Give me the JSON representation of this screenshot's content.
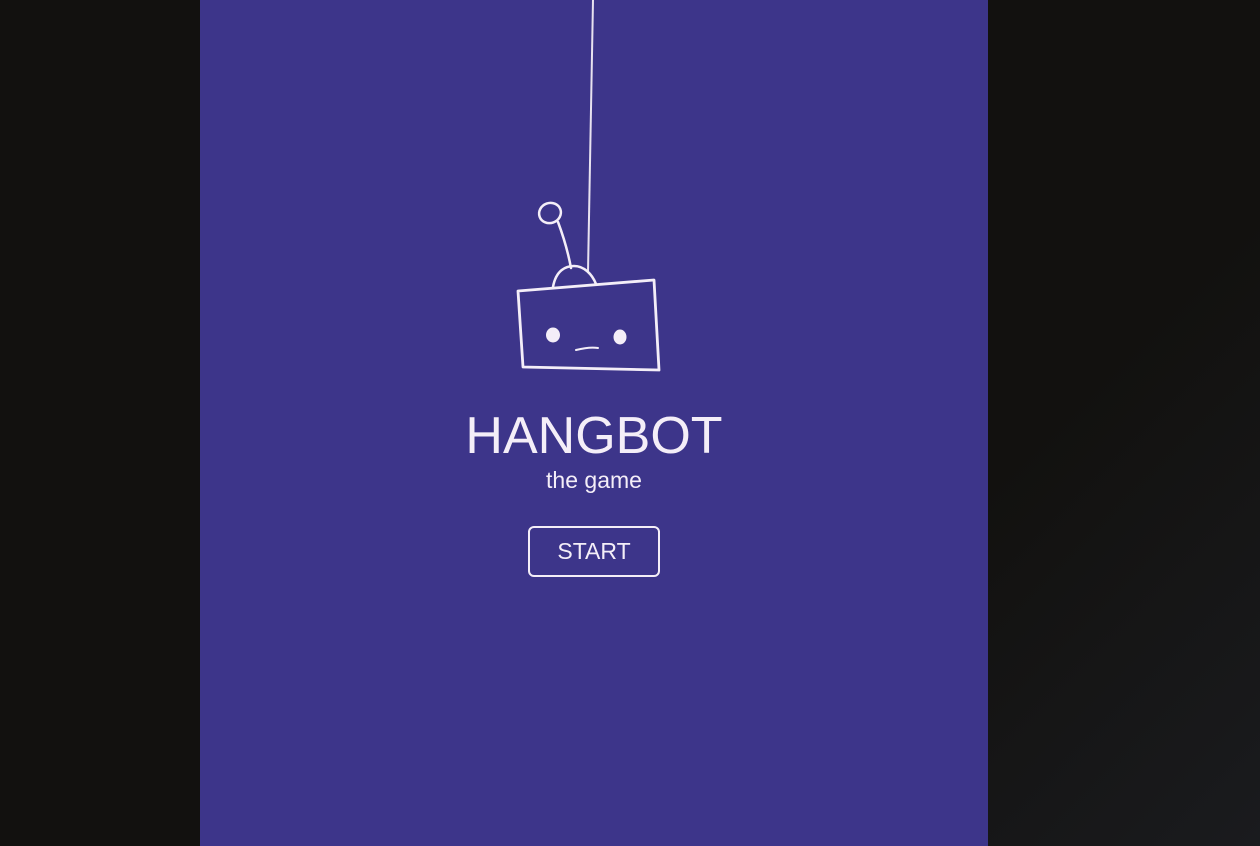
{
  "game": {
    "title": "HANGBOT",
    "subtitle": "the game",
    "start_label": "START"
  },
  "icons": {
    "mascot": "hanging-robot-icon"
  },
  "colors": {
    "panel_background": "#3d358a",
    "foreground": "#f4eef8",
    "page_background": "#12110f"
  }
}
